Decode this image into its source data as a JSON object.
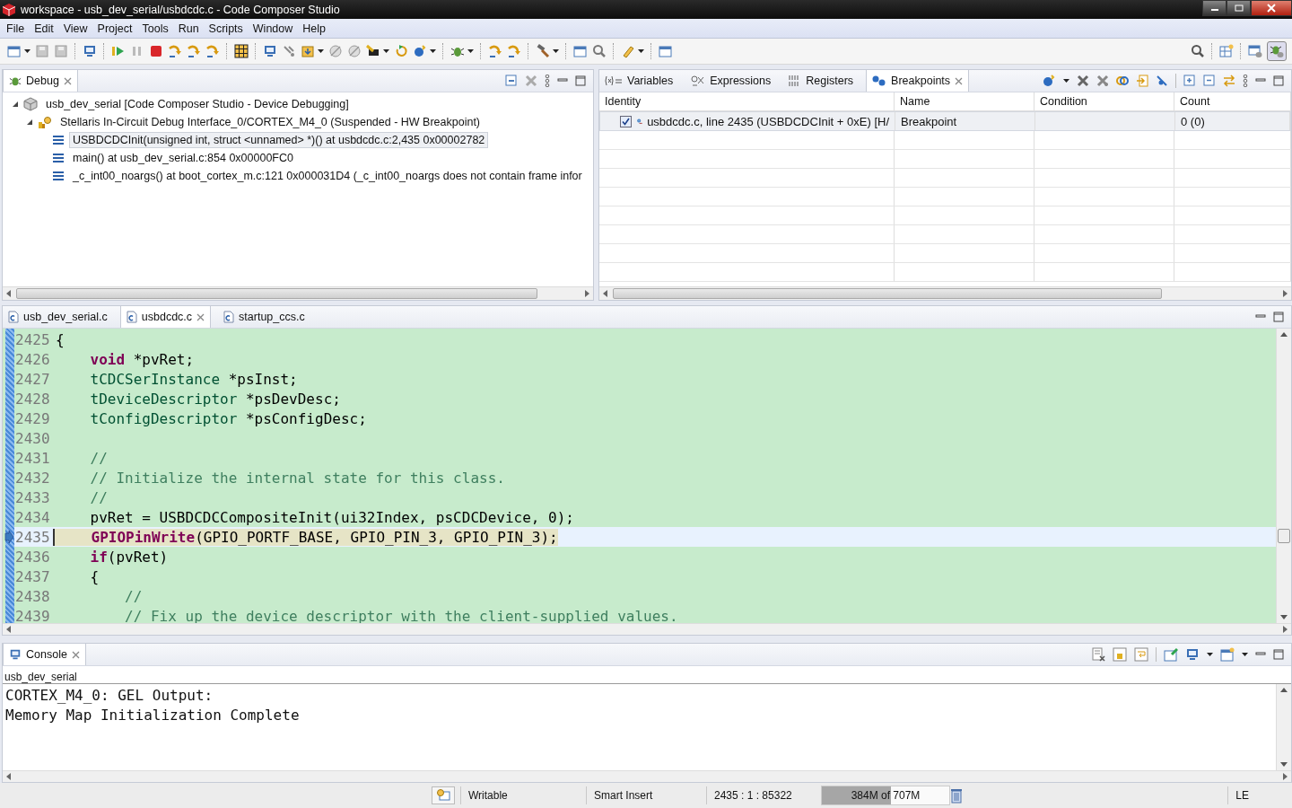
{
  "window": {
    "title": "workspace - usb_dev_serial/usbdcdc.c - Code Composer Studio"
  },
  "menu": [
    "File",
    "Edit",
    "View",
    "Project",
    "Tools",
    "Run",
    "Scripts",
    "Window",
    "Help"
  ],
  "debug": {
    "tabs": [
      {
        "label": "Debug",
        "selected": true
      }
    ],
    "tree": [
      {
        "label": "usb_dev_serial [Code Composer Studio - Device Debugging]",
        "kind": "launch",
        "expanded": true,
        "selected": false,
        "children": [
          {
            "label": "Stellaris In-Circuit Debug Interface_0/CORTEX_M4_0 (Suspended - HW Breakpoint)",
            "kind": "thread",
            "expanded": true,
            "selected": false,
            "children": [
              {
                "label": "USBDCDCInit(unsigned int, struct <unnamed> *)() at usbdcdc.c:2,435 0x00002782",
                "kind": "frame",
                "selected": true
              },
              {
                "label": "main() at usb_dev_serial.c:854 0x00000FC0",
                "kind": "frame",
                "selected": false
              },
              {
                "label": "_c_int00_noargs() at boot_cortex_m.c:121 0x000031D4  (_c_int00_noargs does not contain frame infor",
                "kind": "frame",
                "selected": false
              }
            ]
          }
        ]
      }
    ]
  },
  "views": {
    "tabs": [
      {
        "label": "Variables",
        "kind": "variables",
        "selected": false
      },
      {
        "label": "Expressions",
        "kind": "expressions",
        "selected": false
      },
      {
        "label": "Registers",
        "kind": "registers",
        "selected": false
      },
      {
        "label": "Breakpoints",
        "kind": "breakpoints",
        "selected": true
      }
    ],
    "columns": [
      "Identity",
      "Name",
      "Condition",
      "Count"
    ],
    "rows": [
      {
        "identity": "usbdcdc.c, line 2435 (USBDCDCInit + 0xE)  [H/",
        "name": "Breakpoint",
        "condition": "",
        "count": "0 (0)",
        "checked": true
      }
    ]
  },
  "editor": {
    "tabs": [
      {
        "label": "usb_dev_serial.c",
        "selected": false
      },
      {
        "label": "usbdcdc.c",
        "selected": true
      },
      {
        "label": "startup_ccs.c",
        "selected": false
      }
    ],
    "lines": [
      {
        "number": "2425",
        "current": false,
        "segments": [
          {
            "text": "{",
            "kind": "plain"
          }
        ]
      },
      {
        "number": "2426",
        "current": false,
        "segments": [
          {
            "text": "    void",
            "kind": "keyword"
          },
          {
            "text": " *pvRet;",
            "kind": "plain"
          }
        ]
      },
      {
        "number": "2427",
        "current": false,
        "segments": [
          {
            "text": "    tCDCSerInstance",
            "kind": "type"
          },
          {
            "text": " *psInst;",
            "kind": "plain"
          }
        ]
      },
      {
        "number": "2428",
        "current": false,
        "segments": [
          {
            "text": "    tDeviceDescriptor",
            "kind": "type"
          },
          {
            "text": " *psDevDesc;",
            "kind": "plain"
          }
        ]
      },
      {
        "number": "2429",
        "current": false,
        "segments": [
          {
            "text": "    tConfigDescriptor",
            "kind": "type"
          },
          {
            "text": " *psConfigDesc;",
            "kind": "plain"
          }
        ]
      },
      {
        "number": "2430",
        "current": false
      },
      {
        "number": "2431",
        "current": false,
        "segments": [
          {
            "text": "    //",
            "kind": "comment"
          }
        ]
      },
      {
        "number": "2432",
        "current": false,
        "segments": [
          {
            "text": "    // Initialize the internal state for this class.",
            "kind": "comment"
          }
        ]
      },
      {
        "number": "2433",
        "current": false,
        "segments": [
          {
            "text": "    //",
            "kind": "comment"
          }
        ]
      },
      {
        "number": "2434",
        "current": false,
        "segments": [
          {
            "text": "    pvRet = USBDCDCCompositeInit(ui32Index, psCDCDevice, 0);",
            "kind": "plain"
          }
        ]
      },
      {
        "number": "2435",
        "current": true,
        "segments": [
          {
            "text": "    GPIOPinWrite",
            "kind": "function"
          },
          {
            "text": "(GPIO_PORTF_BASE, GPIO_PIN_3, GPIO_PIN_3);",
            "kind": "plain"
          }
        ]
      },
      {
        "number": "2436",
        "current": false,
        "segments": [
          {
            "text": "    if",
            "kind": "keyword"
          },
          {
            "text": "(pvRet)",
            "kind": "plain"
          }
        ]
      },
      {
        "number": "2437",
        "current": false,
        "segments": [
          {
            "text": "    {",
            "kind": "plain"
          }
        ]
      },
      {
        "number": "2438",
        "current": false,
        "segments": [
          {
            "text": "        //",
            "kind": "comment"
          }
        ]
      },
      {
        "number": "2439",
        "current": false,
        "segments": [
          {
            "text": "        // Fix up the device descriptor with the client-supplied values.",
            "kind": "comment"
          }
        ]
      }
    ]
  },
  "console": {
    "tabs": [
      {
        "label": "Console",
        "selected": true
      }
    ],
    "session": "usb_dev_serial",
    "lines": [
      "CORTEX_M4_0: GEL Output:",
      "Memory Map Initialization Complete"
    ]
  },
  "status_bar": {
    "mode": "Writable",
    "insert": "Smart Insert",
    "position": "2435 : 1 : 85322",
    "heap": {
      "text": "384M of 707M",
      "level": 0.543
    },
    "byte_order": "LE"
  }
}
